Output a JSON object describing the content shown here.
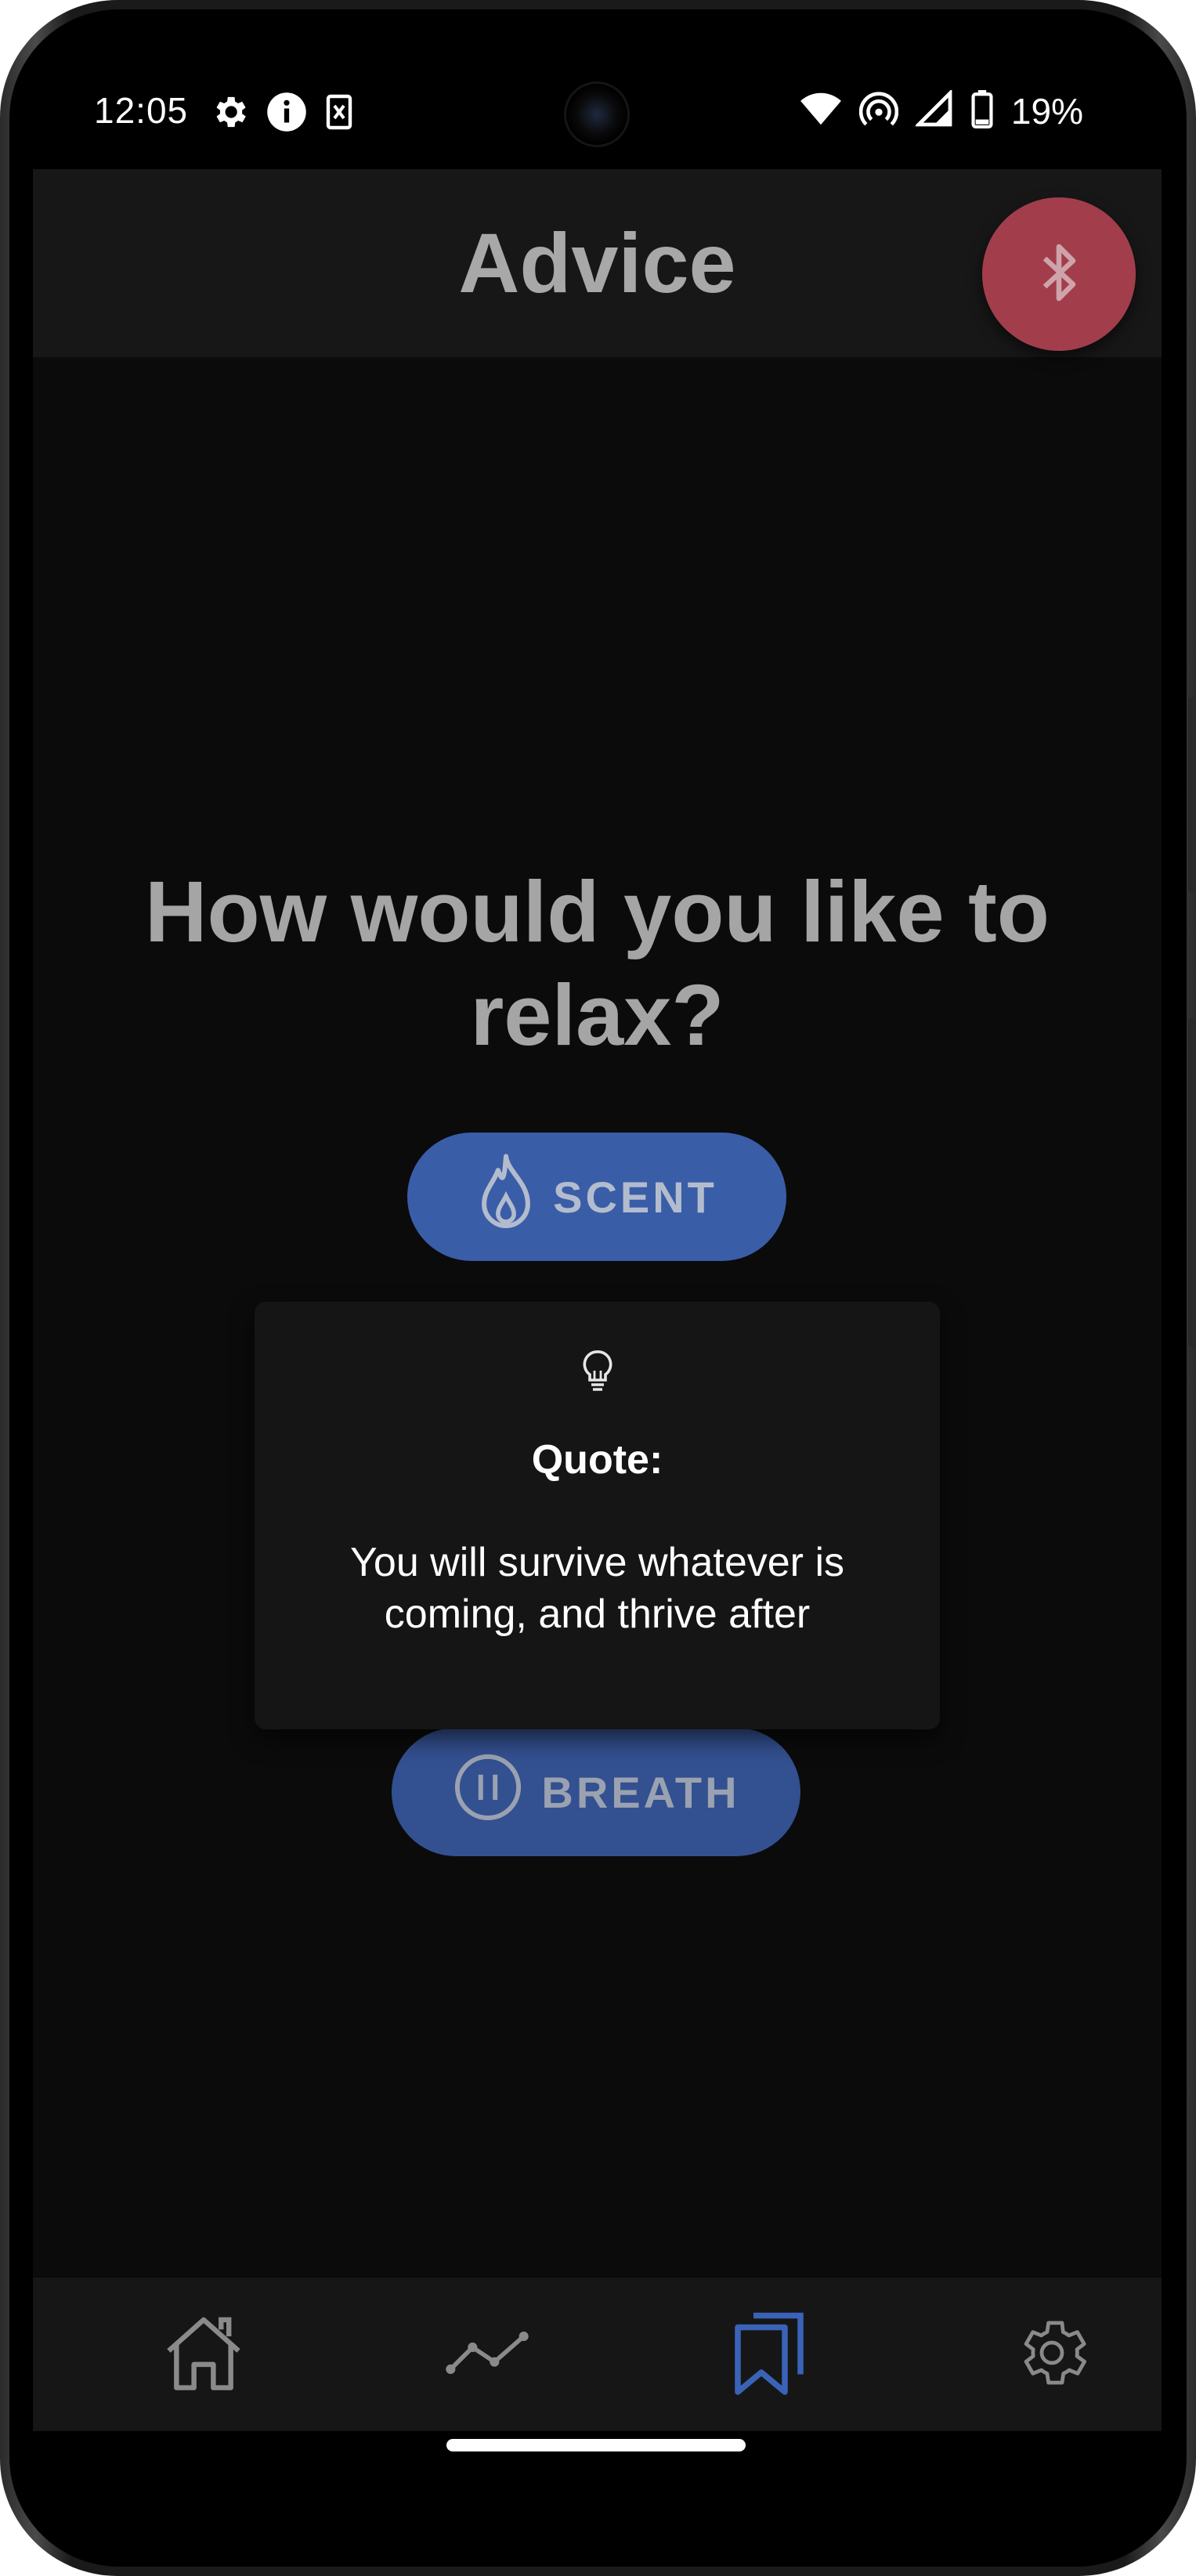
{
  "status_bar": {
    "time": "12:05",
    "battery": "19%",
    "left_icons": [
      "settings-gear-icon",
      "info-icon",
      "sim-card-icon"
    ],
    "right_icons": [
      "wifi-icon",
      "hotspot-icon",
      "signal-icon",
      "battery-icon"
    ]
  },
  "app_bar": {
    "title": "Advice",
    "fab_icon": "bluetooth-icon",
    "fab_color": "#a23e4b"
  },
  "main": {
    "question": "How would you like to relax?",
    "buttons": [
      {
        "label": "SCENT",
        "icon": "flame-icon"
      },
      {
        "label": "BREATH",
        "icon": "breath-icon"
      }
    ],
    "button_color": "#3a5da8"
  },
  "dialog": {
    "icon": "lightbulb-icon",
    "title": "Quote:",
    "body": "You will survive whatever is coming, and thrive after"
  },
  "bottom_nav": {
    "items": [
      {
        "icon": "home-icon",
        "active": false
      },
      {
        "icon": "trend-chart-icon",
        "active": false
      },
      {
        "icon": "bookmarks-icon",
        "active": true
      },
      {
        "icon": "settings-icon",
        "active": false
      }
    ],
    "active_color": "#3a63b8",
    "inactive_color": "#8a8a8a"
  }
}
